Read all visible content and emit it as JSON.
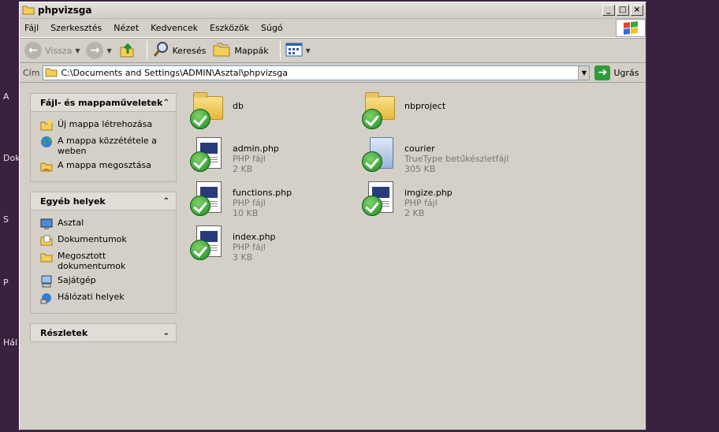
{
  "desktop": {
    "labels": [
      "A",
      "Dok",
      "S",
      "P",
      "Hál"
    ]
  },
  "window": {
    "title": "phpvizsga",
    "minimize": "_",
    "maximize": "□",
    "close": "×"
  },
  "menu": {
    "items": [
      "Fájl",
      "Szerkesztés",
      "Nézet",
      "Kedvencek",
      "Eszközök",
      "Súgó"
    ]
  },
  "toolbar": {
    "back": "Vissza",
    "search": "Keresés",
    "folders": "Mappák"
  },
  "address": {
    "label": "Cím",
    "path": "C:\\Documents and Settings\\ADMIN\\Asztal\\phpvizsga",
    "go": "Ugrás"
  },
  "sidebar": {
    "file_tasks": {
      "title": "Fájl- és mappaműveletek",
      "items": [
        {
          "label": "Új mappa létrehozása",
          "icon": "new-folder-icon"
        },
        {
          "label": "A mappa közzététele a weben",
          "icon": "globe-icon"
        },
        {
          "label": "A mappa megosztása",
          "icon": "share-folder-icon"
        }
      ]
    },
    "other_places": {
      "title": "Egyéb helyek",
      "items": [
        {
          "label": "Asztal",
          "icon": "desktop-icon"
        },
        {
          "label": "Dokumentumok",
          "icon": "documents-icon"
        },
        {
          "label": "Megosztott dokumentumok",
          "icon": "shared-docs-icon"
        },
        {
          "label": "Sajátgép",
          "icon": "computer-icon"
        },
        {
          "label": "Hálózati helyek",
          "icon": "network-icon"
        }
      ]
    },
    "details": {
      "title": "Részletek"
    }
  },
  "files": [
    {
      "name": "db",
      "type": "",
      "size": "",
      "kind": "folder"
    },
    {
      "name": "nbproject",
      "type": "",
      "size": "",
      "kind": "folder"
    },
    {
      "name": "admin.php",
      "type": "PHP fájl",
      "size": "2 KB",
      "kind": "php"
    },
    {
      "name": "courier",
      "type": "TrueType betűkészletfájl",
      "size": "305 KB",
      "kind": "font"
    },
    {
      "name": "functions.php",
      "type": "PHP fájl",
      "size": "10 KB",
      "kind": "php"
    },
    {
      "name": "imgize.php",
      "type": "PHP fájl",
      "size": "2 KB",
      "kind": "php"
    },
    {
      "name": "index.php",
      "type": "PHP fájl",
      "size": "3 KB",
      "kind": "php"
    }
  ]
}
